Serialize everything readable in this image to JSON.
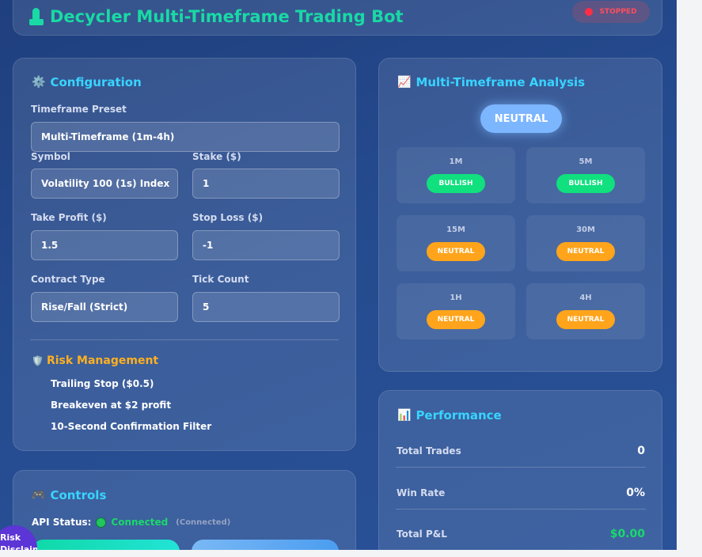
{
  "header": {
    "title": "Decycler Multi-Timeframe Trading Bot",
    "status": "STOPPED",
    "status_color": "#ff2d46",
    "icon": "robot-icon"
  },
  "config": {
    "title": "Configuration",
    "icon": "gear-icon",
    "timeframe_preset_label": "Timeframe Preset",
    "timeframe_preset_value": "Multi-Timeframe (1m-4h)",
    "symbol_label": "Symbol",
    "symbol_value": "Volatility 100 (1s) Index",
    "stake_label": "Stake ($)",
    "stake_value": "1",
    "take_profit_label": "Take Profit ($)",
    "take_profit_value": "1.5",
    "stop_loss_label": "Stop Loss ($)",
    "stop_loss_value": "-1",
    "contract_type_label": "Contract Type",
    "contract_type_value": "Rise/Fall (Strict)",
    "tick_count_label": "Tick Count",
    "tick_count_value": "5"
  },
  "risk": {
    "title": "Risk Management",
    "icon": "shield-icon",
    "items": [
      "Trailing Stop ($0.5)",
      "Breakeven at $2 profit",
      "10-Second Confirmation Filter"
    ]
  },
  "analysis": {
    "title": "Multi-Timeframe Analysis",
    "icon": "chart-icon",
    "overall": "NEUTRAL",
    "timeframes": [
      {
        "name": "1M",
        "signal": "BULLISH"
      },
      {
        "name": "5M",
        "signal": "BULLISH"
      },
      {
        "name": "15M",
        "signal": "NEUTRAL"
      },
      {
        "name": "30M",
        "signal": "NEUTRAL"
      },
      {
        "name": "1H",
        "signal": "NEUTRAL"
      },
      {
        "name": "4H",
        "signal": "NEUTRAL"
      }
    ],
    "colors": {
      "bullish": "#10e07e",
      "neutral": "#ffa41b"
    }
  },
  "performance": {
    "title": "Performance",
    "icon": "bar-chart-icon",
    "total_trades_label": "Total Trades",
    "total_trades_value": "0",
    "win_rate_label": "Win Rate",
    "win_rate_value": "0%",
    "total_pnl_label": "Total P&L",
    "total_pnl_value": "$0.00"
  },
  "controls": {
    "title": "Controls",
    "icon": "gamepad-icon",
    "api_status_label": "API Status:",
    "api_status_value": "Connected",
    "api_status_sub": "(Connected)"
  },
  "risk_bubble": {
    "text": "Risk Disclaimer"
  }
}
